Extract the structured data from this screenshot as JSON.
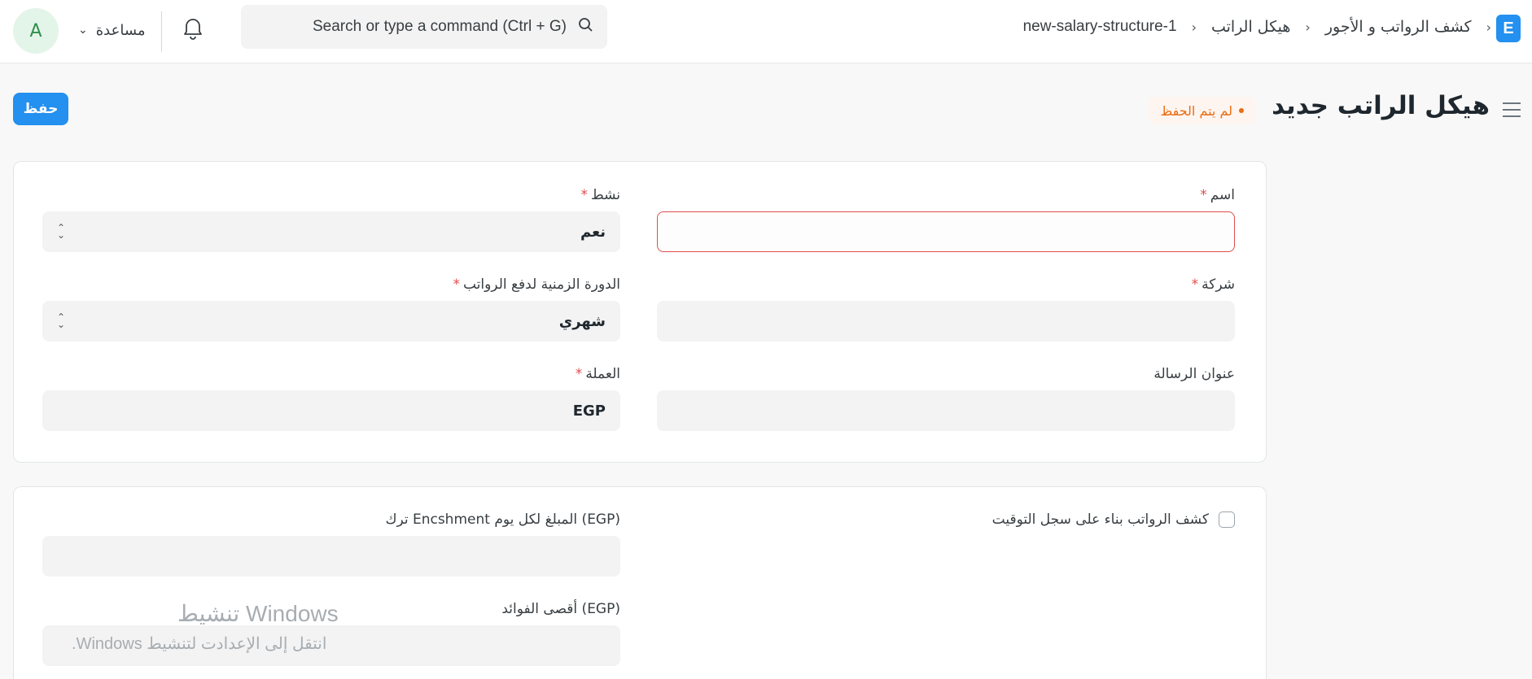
{
  "navbar": {
    "avatar_letter": "A",
    "help_label": "مساعدة",
    "search_placeholder": "Search or type a command (Ctrl + G)",
    "breadcrumbs": [
      "كشف الرواتب و الأجور",
      "هيكل الراتب",
      "new-salary-structure-1"
    ],
    "logo_letter": "E"
  },
  "page": {
    "title": "هيكل الراتب جديد",
    "status": "لم يتم الحفظ",
    "save_label": "حفظ"
  },
  "form": {
    "name": {
      "label": "اسم",
      "value": ""
    },
    "active": {
      "label": "نشط",
      "value": "نعم"
    },
    "company": {
      "label": "شركة",
      "value": ""
    },
    "payroll_frequency": {
      "label": "الدورة الزمنية لدفع الرواتب",
      "value": "شهري"
    },
    "letter_head": {
      "label": "عنوان الرسالة",
      "value": ""
    },
    "currency": {
      "label": "العملة",
      "value": "EGP"
    },
    "timesheet_checkbox": {
      "label": "كشف الرواتب بناء على سجل التوقيت",
      "checked": false
    },
    "leave_encashment": {
      "label": "ترك Encshment المبلغ لكل يوم (EGP)",
      "value": ""
    },
    "max_benefits": {
      "label": "أقصى الفوائد (EGP)",
      "value": ""
    }
  },
  "watermark": {
    "line1": "تنشيط Windows",
    "line2": "انتقل إلى الإعدادت لتنشيط Windows."
  },
  "colors": {
    "primary": "#2490ef",
    "required": "#e24c4c",
    "status": "#e86c13",
    "avatar_bg": "#e3f5e8"
  }
}
